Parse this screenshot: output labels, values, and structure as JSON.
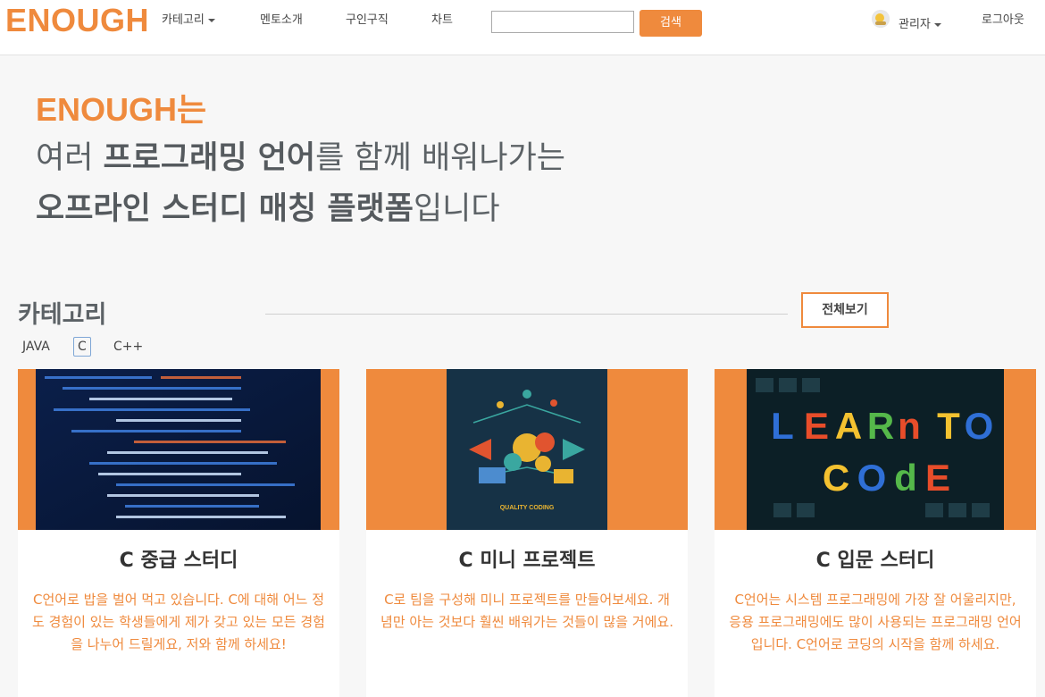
{
  "nav": {
    "logo": "ENOUGH",
    "items": [
      {
        "label": "카테고리",
        "dropdown": true
      },
      {
        "label": "멘토소개"
      },
      {
        "label": "구인구직"
      },
      {
        "label": "차트"
      }
    ],
    "search": {
      "placeholder": "",
      "button_label": "검색"
    },
    "user": {
      "label": "관리자"
    },
    "logout_label": "로그아웃"
  },
  "hero": {
    "brand": "ENOUGH는",
    "line2": {
      "pre": "여러 ",
      "bold": "프로그래밍 언어",
      "post": "를 함께 배워나가는"
    },
    "line3": {
      "bold": "오프라인 스터디 매칭 플랫폼",
      "post": "입니다"
    }
  },
  "category": {
    "title": "카테고리",
    "view_all": "전체보기",
    "tabs": [
      {
        "label": "JAVA",
        "active": false
      },
      {
        "label": "C",
        "active": true
      },
      {
        "label": "C++",
        "active": false
      }
    ]
  },
  "cards": [
    {
      "title": "C 중급 스터디",
      "desc": "C언어로 밥을 벌어 먹고 있습니다. C에 대해 어느 정도 경험이 있는 학생들에게 제가 갖고 있는 모든 경험을 나누어 드릴게요, 저와 함께 하세요!",
      "image": "code-screen-image"
    },
    {
      "title": "C 미니 프로젝트",
      "desc": "C로 팀을 구성해 미니 프로젝트를 만들어보세요. 개념만 아는 것보다 훨씬 배워가는 것들이 많을 거에요.",
      "image": "quality-coding-image",
      "image_caption": "QUALITY CODING"
    },
    {
      "title": "C 입문 스터디",
      "desc": "C언어는 시스템 프로그래밍에 가장 잘 어울리지만, 응용 프로그래밍에도 많이 사용되는 프로그래밍 언어입니다. C언어로 코딩의 시작을 함께 하세요.",
      "image": "learn-to-code-image",
      "image_caption": "LEARn TO COdE"
    }
  ],
  "colors": {
    "accent": "#ef8a3d",
    "text": "#5c6266",
    "bg": "#f7f7f7"
  }
}
